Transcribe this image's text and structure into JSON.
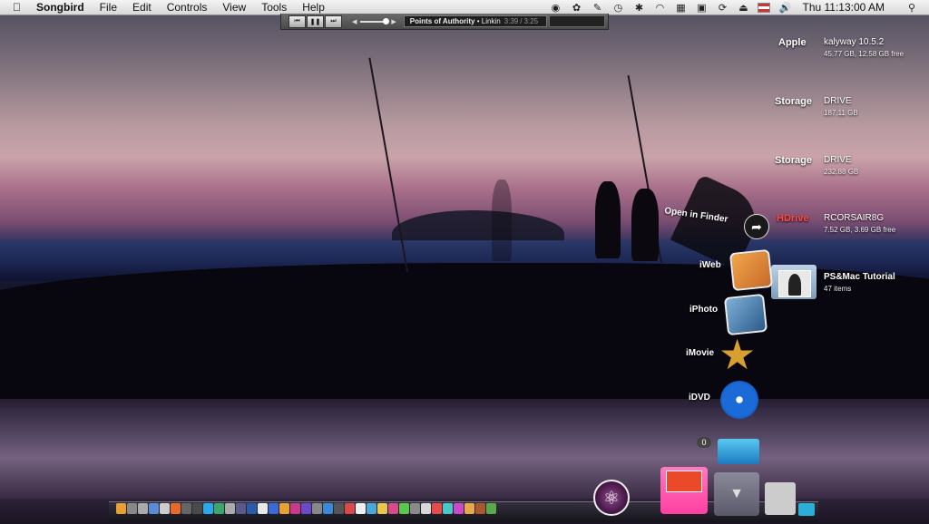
{
  "menubar": {
    "app_name": "Songbird",
    "items": [
      "File",
      "Edit",
      "Controls",
      "View",
      "Tools",
      "Help"
    ],
    "clock": "Thu 11:13:00 AM"
  },
  "player": {
    "track": "Points of Authority",
    "artist": "• Linkin",
    "time_elapsed": "3:39",
    "time_total": "3:25"
  },
  "drives": [
    {
      "label": "Apple",
      "name": "kalyway 10.5.2",
      "sub": "45.77 GB, 12.58 GB free"
    },
    {
      "label": "Storage",
      "name": "DRIVE",
      "sub": "187.11 GB"
    },
    {
      "label": "Storage",
      "name": "DRIVE",
      "sub": "232.88 GB"
    },
    {
      "label": "HDrive",
      "name": "RCORSAIR8G",
      "sub": "7.52 GB, 3.69 GB free"
    },
    {
      "label": "",
      "name": "PS&Mac Tutorial",
      "sub": "47 items"
    }
  ],
  "stack": {
    "open_in_finder": "Open in Finder",
    "items": [
      "iWeb",
      "iPhoto",
      "iMovie",
      "iDVD"
    ],
    "badge": "0"
  },
  "colors": {
    "hdrive_label": "#ff4a4a",
    "accent_pink": "#ff3fa0"
  }
}
